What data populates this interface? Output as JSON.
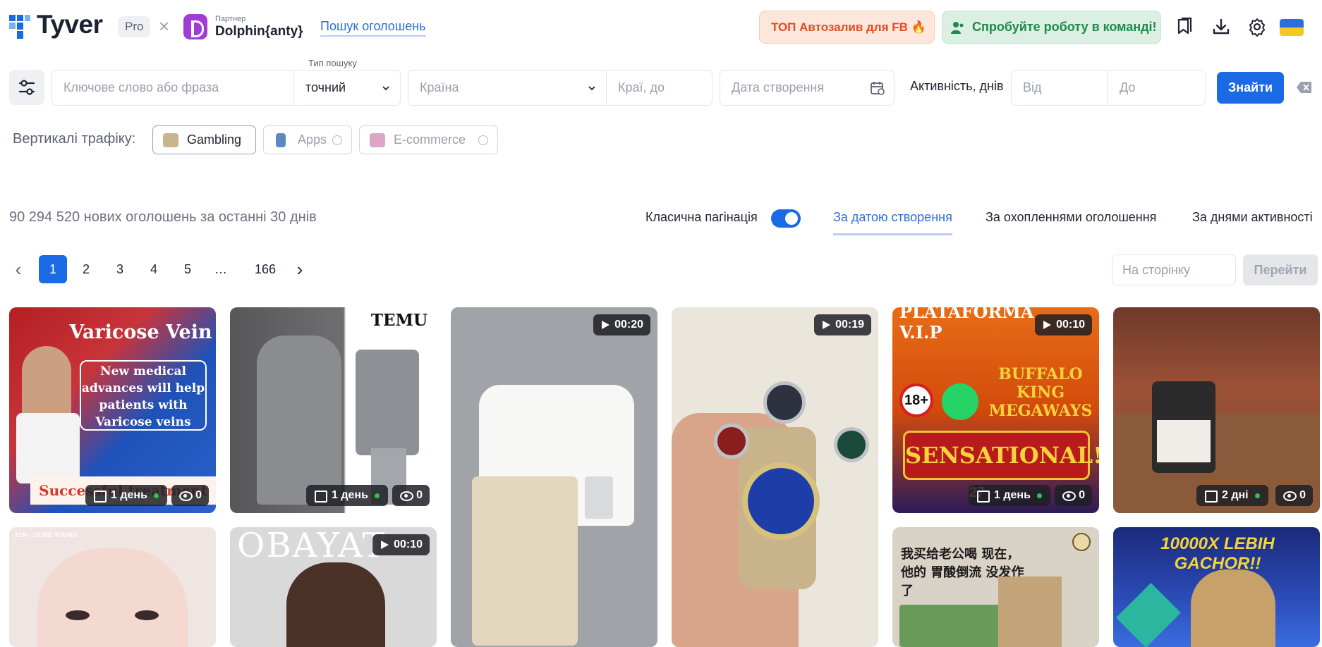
{
  "header": {
    "logo_text": "Tyver",
    "plan_badge": "Pro",
    "separator": "×",
    "partner_label": "Партнер",
    "partner_name": "Dolphin{anty}",
    "search_link": "Пошук оголошень",
    "promo_button": "ТОП Автозалив для FB 🔥",
    "team_button": "Спробуйте роботу в команді!",
    "icons": [
      "bookmarks-icon",
      "download-icon",
      "settings-icon",
      "ukraine-flag-icon"
    ]
  },
  "filters": {
    "keyword_placeholder": "Ключове слово або фраза",
    "search_type_label": "Тип пошуку",
    "search_type_value": "точний",
    "country_placeholder": "Країна",
    "country_to_placeholder": "Краї, до",
    "date_placeholder": "Дата створення",
    "activity_label": "Активність, днів",
    "from_placeholder": "Від",
    "to_placeholder": "До",
    "find_button": "Знайти"
  },
  "verticals": {
    "label": "Вертикалі трафіку:",
    "items": [
      {
        "label": "Gambling",
        "state": "active"
      },
      {
        "label": "Apps",
        "state": "disabled"
      },
      {
        "label": "E-commerce",
        "state": "disabled"
      }
    ]
  },
  "results": {
    "count_text": "90 294 520 нових оголошень за останні 30 днів",
    "pagination_toggle_label": "Класична пагінація",
    "pagination_toggle_on": true,
    "sort_tabs": [
      "За датою створення",
      "За охопленнями оголошення",
      "За днями активності"
    ],
    "active_sort": 0
  },
  "pager": {
    "prev": "‹",
    "pages": [
      "1",
      "2",
      "3",
      "4",
      "5",
      "…",
      "166"
    ],
    "active_page": "1",
    "next": "›",
    "goto_placeholder": "На сторінку",
    "goto_button": "Перейти"
  },
  "cards": [
    {
      "title": "Varicose Vein",
      "quote": "New medical advances will help patients with Varicose veins",
      "banner": "Successful treatment",
      "days": "1 день",
      "views": "0",
      "bg": "#1e4fa8"
    },
    {
      "title": "TEMU",
      "days": "1 день",
      "views": "0",
      "bg": "#6f6f72"
    },
    {
      "duration": "00:20",
      "bg": "#9b9ea3"
    },
    {
      "duration": "00:19",
      "bg": "#e7e2d7"
    },
    {
      "title": "PLATAFORMA V.I.P",
      "badge": "18+",
      "game": "BUFFALO KING MEGAWAYS",
      "banner": "SENSATIONAL!",
      "banner_num": "27",
      "duration": "00:10",
      "days": "1 день",
      "views": "0",
      "bg": "#e05a12"
    },
    {
      "days": "2 дні",
      "views": "0",
      "bg": "#8b4a33"
    },
    {
      "caption": "21% · OLIVE YOUNG",
      "bg": "#efe6e4"
    },
    {
      "title": "OBAYAT",
      "duration": "00:10",
      "bg": "#dcdcdc"
    },
    {
      "caption_cn": "我买给老公喝 现在，他的 胃酸倒流 没发作了",
      "bg": "#d9d2c6"
    },
    {
      "title": "10000X LEBIH GACHOR!!",
      "bg": "#2a3a8a"
    }
  ]
}
